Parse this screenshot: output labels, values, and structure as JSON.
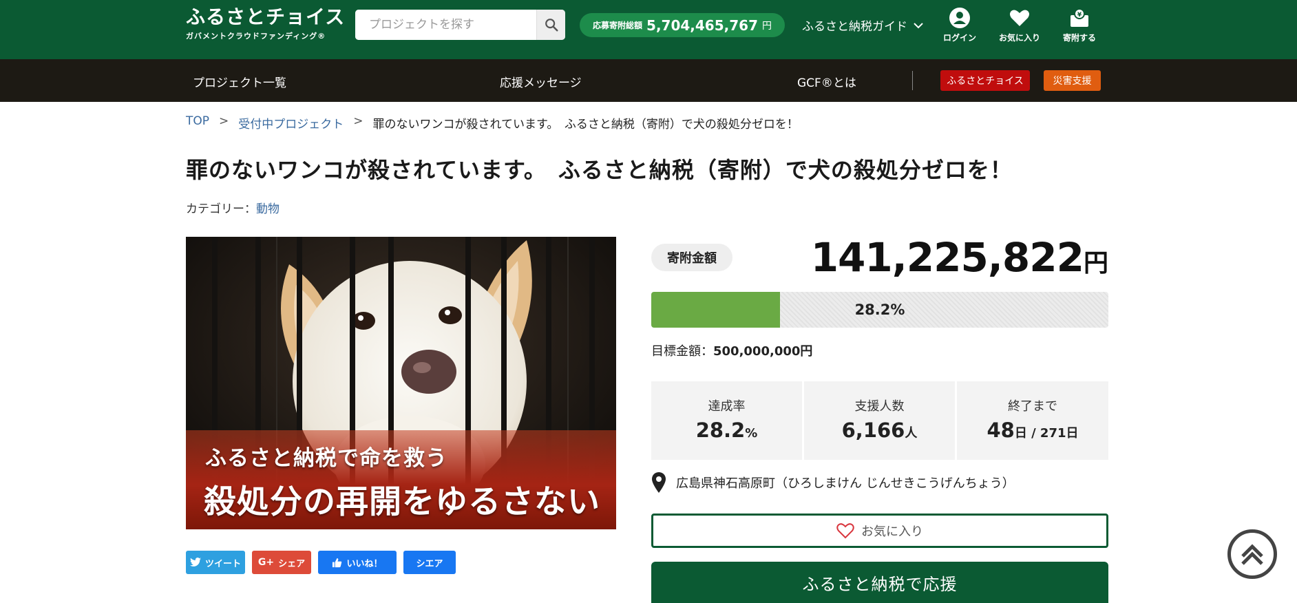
{
  "header": {
    "logo": {
      "title": "ふるさとチョイス",
      "subtitle": "ガバメントクラウドファンディング®"
    },
    "search": {
      "placeholder": "プロジェクトを探す"
    },
    "total": {
      "label": "応募寄附総額",
      "value": "5,704,465,767",
      "unit": "円"
    },
    "guide_label": "ふるさと納税ガイド",
    "icons": [
      {
        "label": "ログイン",
        "icon": "user-icon"
      },
      {
        "label": "お気に入り",
        "icon": "heart-icon"
      },
      {
        "label": "寄附する",
        "icon": "donate-icon"
      }
    ],
    "colors": {
      "primary": "#0b5a33",
      "accent_green": "#1d8c4b"
    }
  },
  "nav": {
    "items": [
      "プロジェクト一覧",
      "応援メッセージ",
      "GCF®とは"
    ],
    "tags": [
      {
        "label": "ふるさとチョイス",
        "color": "#c00d0d"
      },
      {
        "label": "災害支援",
        "color": "#e05d10"
      }
    ]
  },
  "breadcrumb": {
    "top": "TOP",
    "sep": ">",
    "section": "受付中プロジェクト",
    "current": "罪のないワンコが殺されています。　ふるさと納税（寄附）で犬の殺処分ゼロを！"
  },
  "project": {
    "title": "罪のないワンコが殺されています。　ふるさと納税（寄附）で犬の殺処分ゼロを！",
    "category_label": "カテゴリー：",
    "category": "動物",
    "image_text": {
      "line1": "ふるさと納税で命を救う",
      "line2": "殺処分の再開をゆるさない"
    }
  },
  "share": {
    "tweet": "ツイート",
    "gplus": "シェア",
    "like": "いいね！",
    "share": "シエア"
  },
  "funding": {
    "amount_label": "寄附金額",
    "amount": "141,225,822",
    "amount_unit": "円",
    "progress_percent": 28.2,
    "progress_text": "28.2%",
    "goal_label": "目標金額：",
    "goal": "500,000,000円",
    "stats": [
      {
        "label": "達成率",
        "value": "28.2",
        "unit": "%"
      },
      {
        "label": "支援人数",
        "value": "6,166",
        "unit": "人"
      },
      {
        "label": "終了まで",
        "value": "48",
        "unit": "日 / 271日"
      }
    ],
    "location": "広島県神石高原町（ひろしまけん じんせきこうげんちょう）",
    "favorite_label": "お気に入り",
    "cta_label": "ふるさと納税で応援"
  }
}
